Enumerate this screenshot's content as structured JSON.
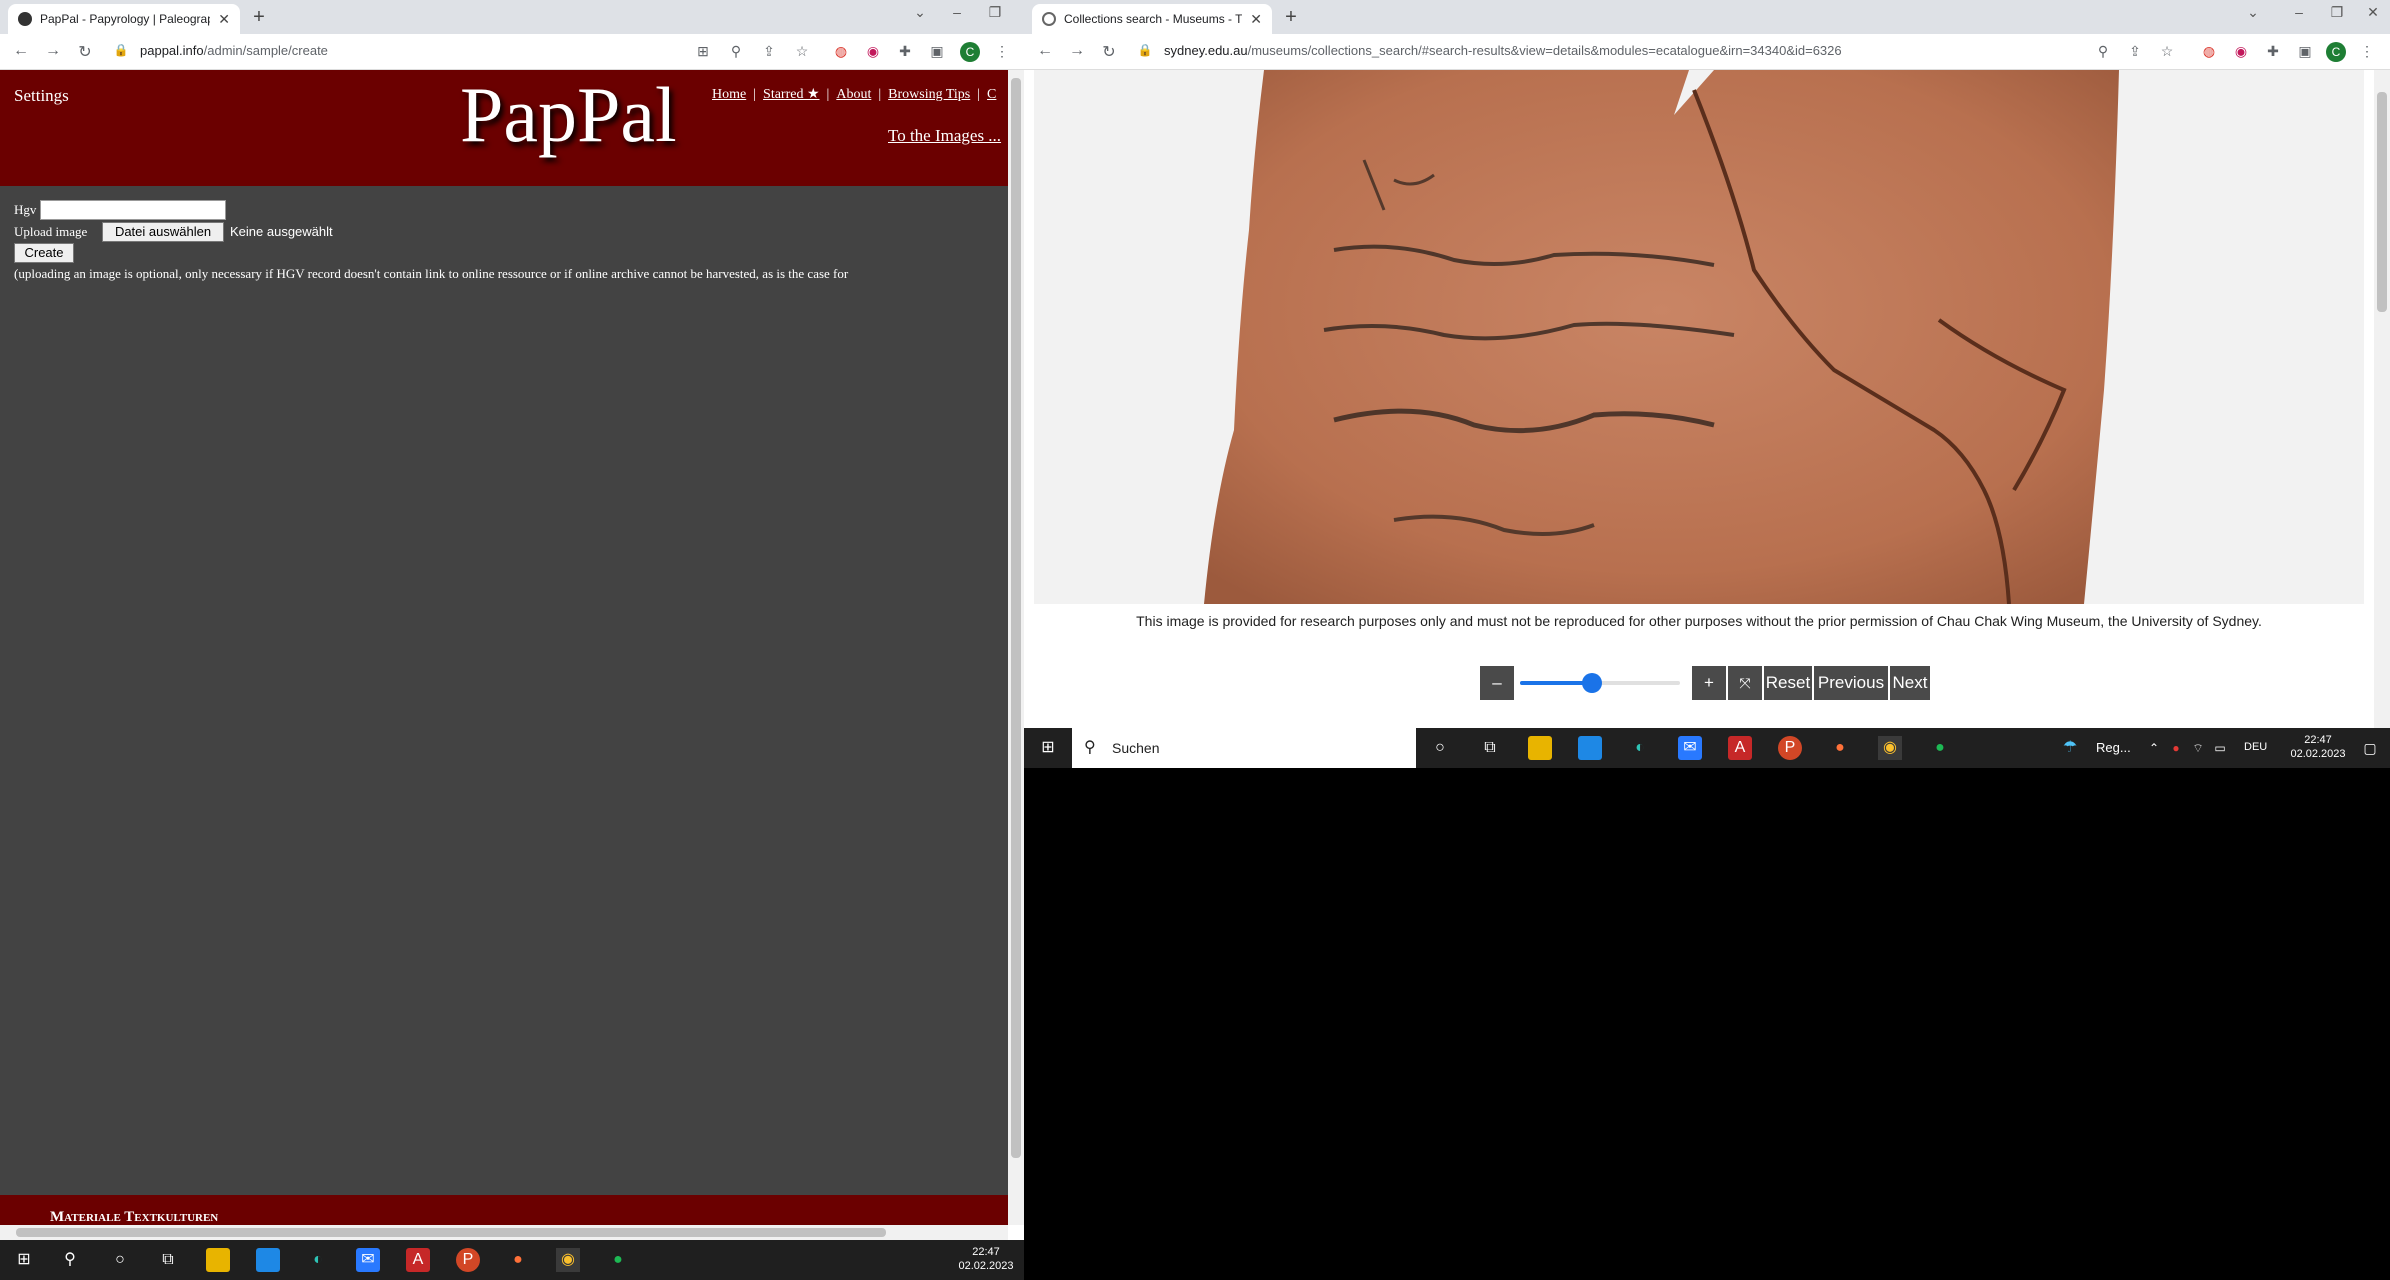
{
  "left_window": {
    "tab_title": "PapPal - Papyrology | Paleograph",
    "url_host": "pappal.info",
    "url_path": "/admin/sample/create",
    "page": {
      "settings_link": "Settings",
      "logo": "PapPal",
      "nav": [
        "Home",
        "Starred ★",
        "About",
        "Browsing Tips",
        "C"
      ],
      "nav_sep": "|",
      "to_images": "To the Images ...",
      "hgv_label": "Hgv",
      "hgv_value": "",
      "upload_label": "Upload image",
      "file_button": "Datei auswählen",
      "file_status": "Keine ausgewählt",
      "create_button": "Create",
      "note": "(uploading an image is optional, only necessary if HGV record doesn't contain link to online ressource or if online archive cannot be harvested, as is the case for",
      "footer": "Materiale Textkulturen"
    }
  },
  "right_window": {
    "tab_title": "Collections search - Museums - T",
    "url_host": "sydney.edu.au",
    "url_path": "/museums/collections_search/#search-results&view=details&modules=ecatalogue&irn=34340&id=6326",
    "caption": "This image is provided for research purposes only and must not be reproduced for other purposes without the prior permission of Chau Chak Wing Museum, the University of Sydney.",
    "controls": {
      "zoom_out": "–",
      "zoom_in": "+",
      "fullscreen": "⤧",
      "reset": "Reset",
      "previous": "Previous",
      "next": "Next",
      "zoom_level_fraction": 0.45
    }
  },
  "profile_initial": "C",
  "taskbar_left": {
    "time": "22:47",
    "date": "02.02.2023"
  },
  "taskbar_right": {
    "search_placeholder": "Suchen",
    "weather": "Reg...",
    "lang": "DEU",
    "time": "22:47",
    "date": "02.02.2023"
  },
  "colors": {
    "header_red": "#6b0000",
    "page_gray": "#434343",
    "accent_blue": "#1a73e8"
  }
}
